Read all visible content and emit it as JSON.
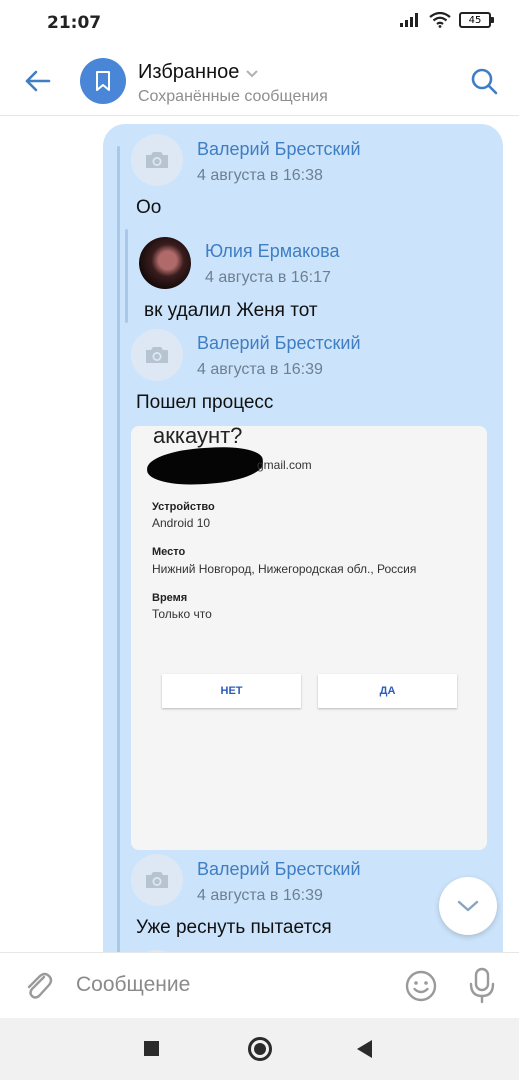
{
  "status_bar": {
    "time": "21:07",
    "battery": "45"
  },
  "header": {
    "title": "Избранное",
    "subtitle": "Сохранённые сообщения"
  },
  "messages": [
    {
      "author": "Валерий Брестский",
      "date": "4 августа в 16:38",
      "text": "Оо"
    },
    {
      "author": "Юлия Ермакова",
      "date": "4 августа в 16:17",
      "text": "вк удалил Женя тот"
    },
    {
      "author": "Валерий Брестский",
      "date": "4 августа в 16:39",
      "text": "Пошел процесс"
    },
    {
      "author": "Валерий Брестский",
      "date": "4 августа в 16:39",
      "text": "Уже реснуть пытается"
    }
  ],
  "screenshot": {
    "question": "аккаунт?",
    "email": "gmail.com",
    "device_label": "Устройство",
    "device_value": "Android 10",
    "place_label": "Место",
    "place_value": "Нижний Новгород, Нижегородская обл., Россия",
    "time_label": "Время",
    "time_value": "Только что",
    "no_button": "НЕТ",
    "yes_button": "ДА"
  },
  "compose": {
    "placeholder": "Сообщение"
  },
  "colors": {
    "accent": "#4a86d8",
    "bubble": "#cce4fb",
    "author": "#3f7ec4"
  },
  "icons": [
    "back-arrow-icon",
    "bookmark-icon",
    "chevron-down-icon",
    "search-icon",
    "camera-icon",
    "chevron-down-icon",
    "paperclip-icon",
    "smile-icon",
    "microphone-icon"
  ]
}
